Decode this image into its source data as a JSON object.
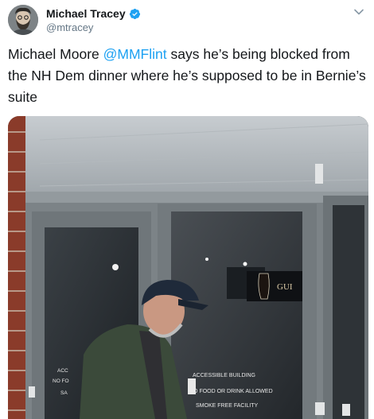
{
  "author": {
    "display_name": "Michael Tracey",
    "handle": "@mtracey",
    "verified": true,
    "avatar_icon": "bearded-man-avatar"
  },
  "tweet": {
    "text_before": "Michael Moore ",
    "mention": "@MMFlint",
    "text_after": " says he’s being blocked from the NH Dem dinner where he’s supposed to be in Bernie’s suite"
  },
  "media": {
    "signs": {
      "left_door": [
        "ACC",
        "NO FO",
        "SA"
      ],
      "right_door": [
        "ACCESSIBLE BUILDING",
        "NO FOOD OR DRINK ALLOWED",
        "SMOKE FREE FACILITY"
      ],
      "ad_text": "GUI"
    }
  },
  "colors": {
    "accent": "#1da1f2",
    "secondary_text": "#657786",
    "primary_text": "#14171a"
  }
}
